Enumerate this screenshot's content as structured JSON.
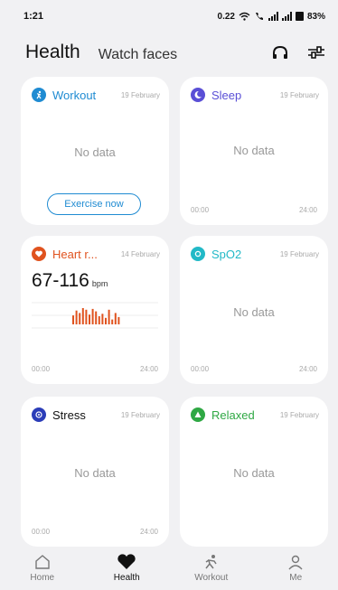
{
  "status": {
    "time": "1:21",
    "net_speed": "0.22",
    "battery": "83%"
  },
  "header": {
    "title": "Health",
    "tab_watch_faces": "Watch faces"
  },
  "cards": {
    "workout": {
      "title": "Workout",
      "date": "19 February",
      "empty": "No data",
      "button": "Exercise now",
      "icon": "running-icon",
      "color": "#1f8bd2"
    },
    "sleep": {
      "title": "Sleep",
      "date": "19 February",
      "empty": "No data",
      "axis_start": "00:00",
      "axis_end": "24:00",
      "icon": "moon-icon",
      "color": "#5a4fd6"
    },
    "heart_rate": {
      "title": "Heart r...",
      "date": "14 February",
      "value": "67-116",
      "unit": "bpm",
      "axis_start": "00:00",
      "axis_end": "24:00",
      "icon": "heart-icon",
      "color": "#e0531f"
    },
    "spo2": {
      "title": "SpO2",
      "date": "19 February",
      "empty": "No data",
      "axis_start": "00:00",
      "axis_end": "24:00",
      "icon": "spo2-icon",
      "color": "#22b9c7"
    },
    "stress": {
      "title": "Stress",
      "date": "19 February",
      "empty": "No data",
      "axis_start": "00:00",
      "axis_end": "24:00",
      "icon": "stress-icon",
      "color": "#2b3db8"
    },
    "relaxed": {
      "title": "Relaxed",
      "date": "19 February",
      "empty": "No data",
      "axis_start": "00:00",
      "axis_end": "24:00",
      "icon": "relaxed-icon",
      "color": "#2fa844"
    }
  },
  "chart_data": {
    "type": "bar",
    "series": [
      {
        "values": [
          0.55,
          0.85,
          0.7,
          1.0,
          0.9,
          0.6,
          0.95,
          0.8,
          0.5,
          0.65,
          0.4,
          0.9,
          0.3,
          0.7,
          0.45
        ]
      }
    ]
  },
  "nav": [
    {
      "label": "Home",
      "icon": "home-icon",
      "active": false
    },
    {
      "label": "Health",
      "icon": "heart-icon",
      "active": true
    },
    {
      "label": "Workout",
      "icon": "running-icon",
      "active": false
    },
    {
      "label": "Me",
      "icon": "person-icon",
      "active": false
    }
  ]
}
